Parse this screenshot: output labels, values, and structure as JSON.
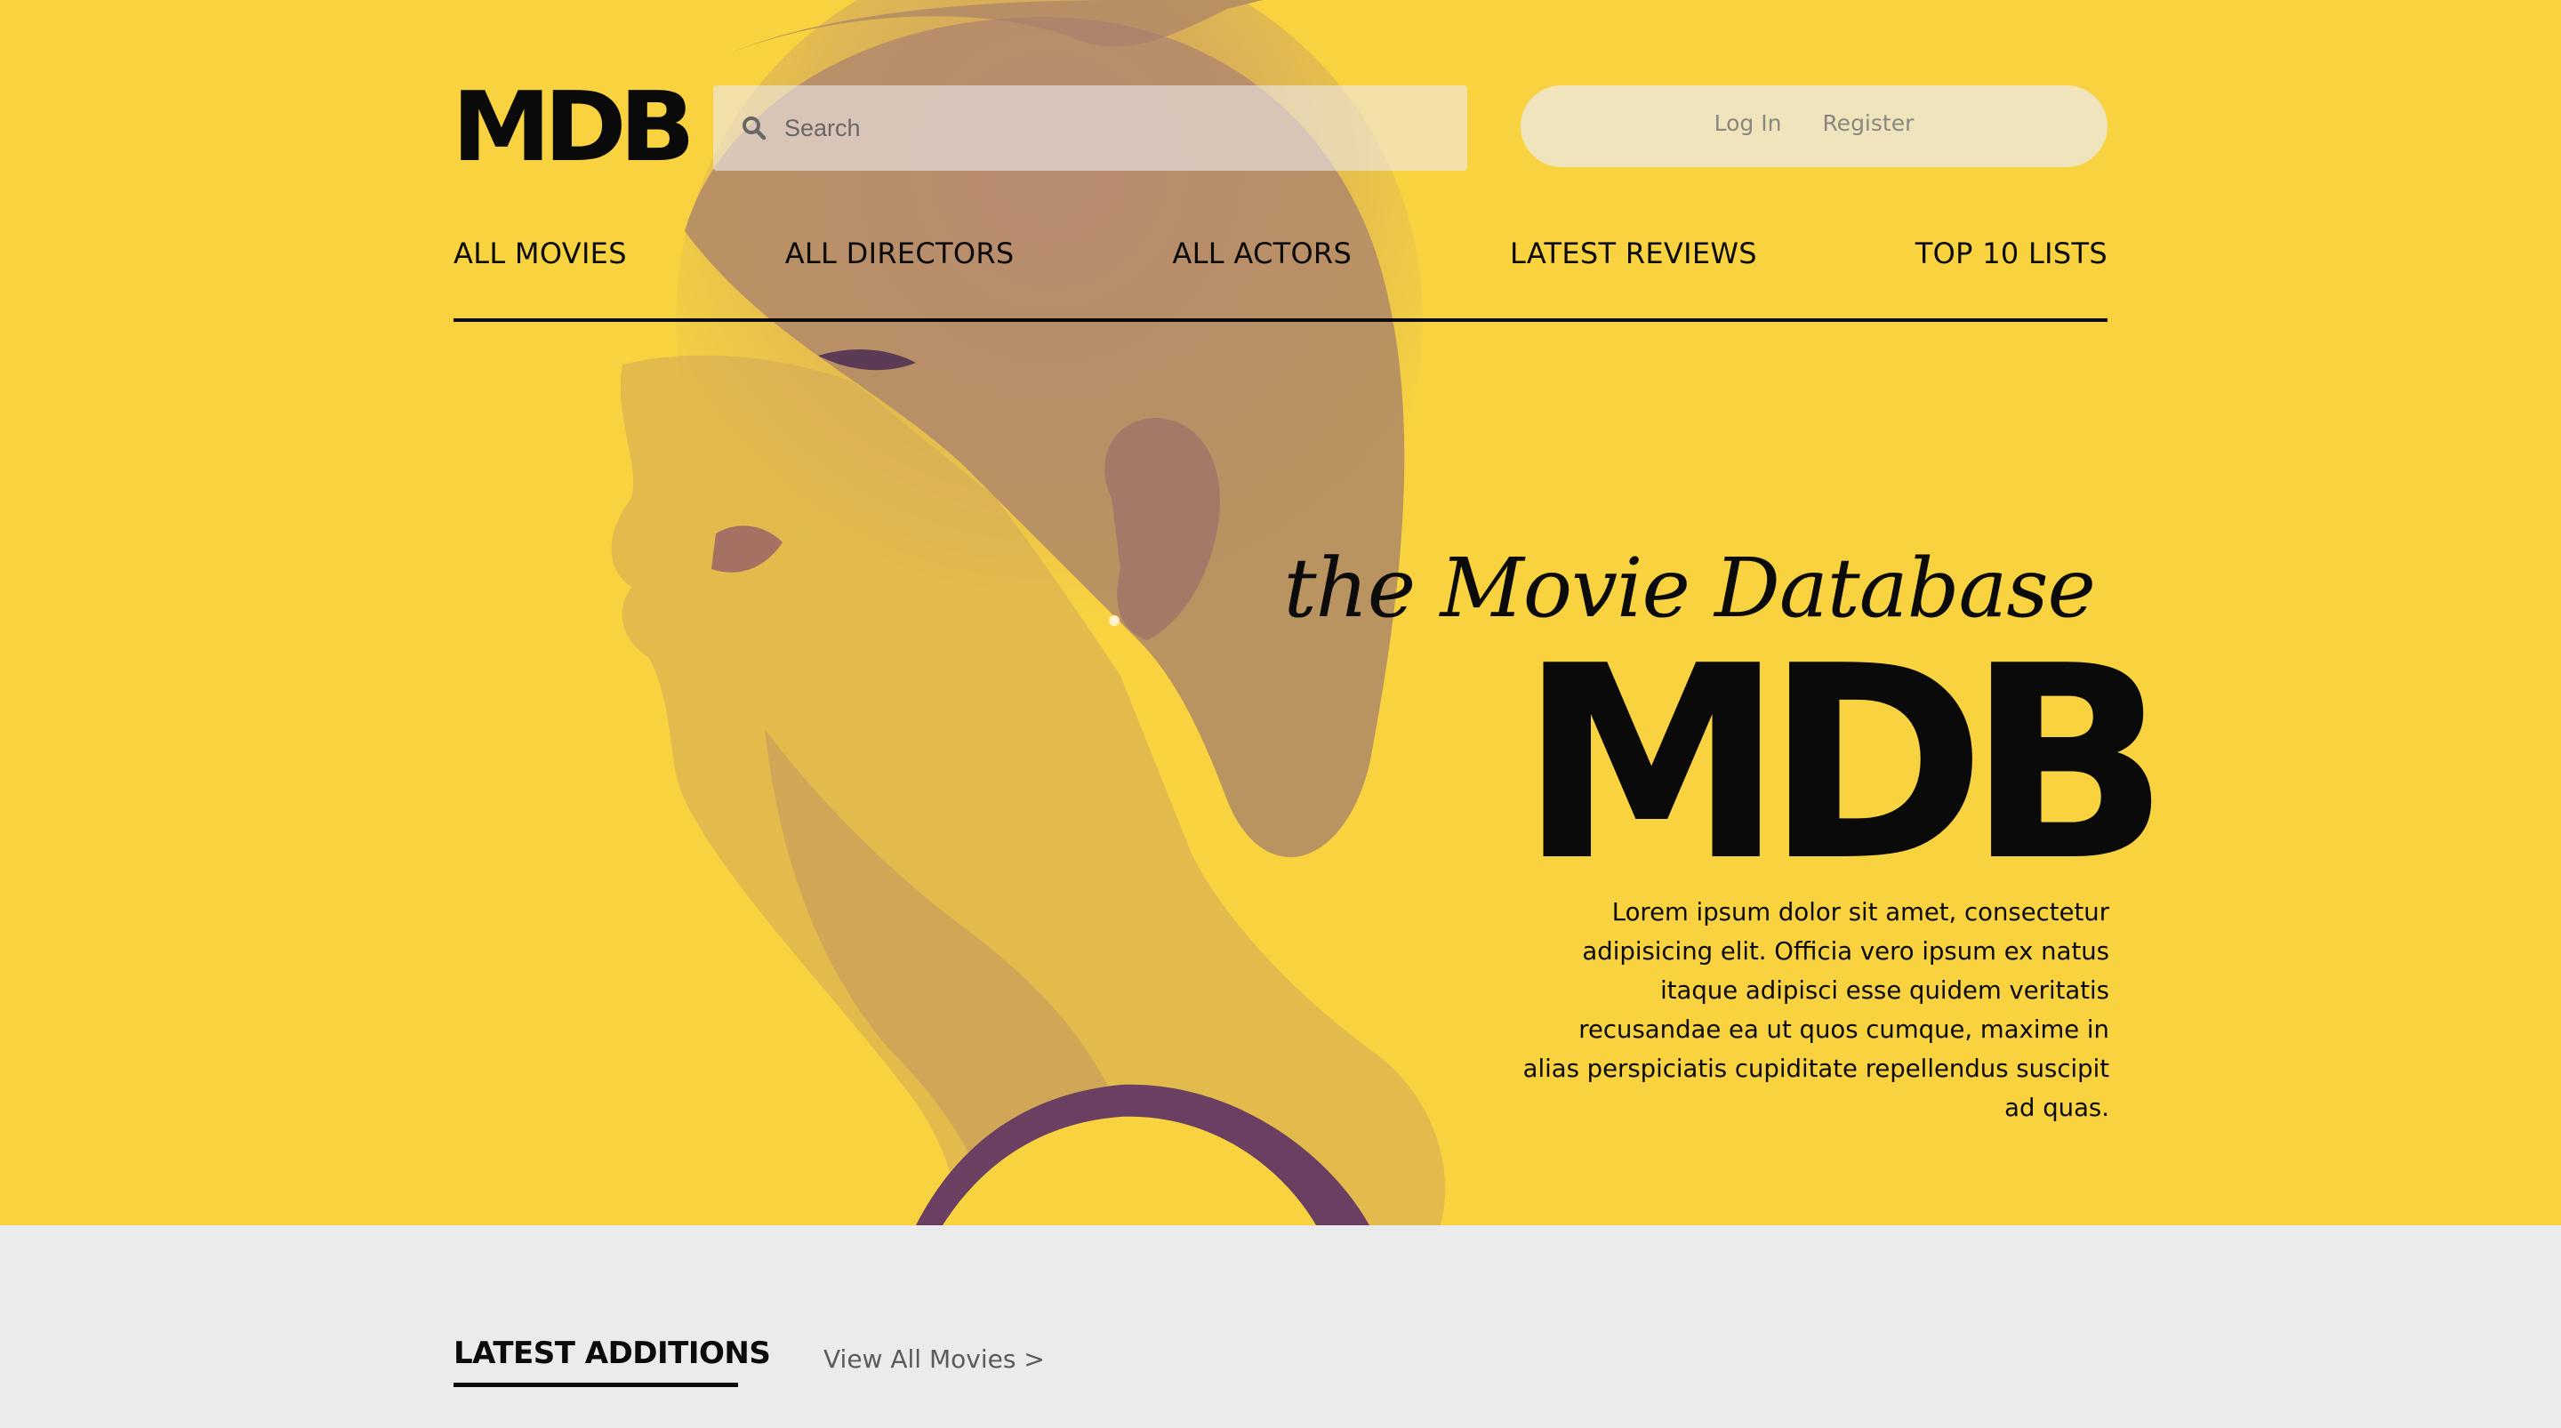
{
  "brand": {
    "logo_text": "MDB"
  },
  "search": {
    "placeholder": "Search",
    "value": ""
  },
  "auth": {
    "login_label": "Log In",
    "register_label": "Register"
  },
  "nav": {
    "items": [
      {
        "label": "ALL MOVIES"
      },
      {
        "label": "ALL DIRECTORS"
      },
      {
        "label": "ALL ACTORS"
      },
      {
        "label": "LATEST REVIEWS"
      },
      {
        "label": "TOP 10 LISTS"
      }
    ]
  },
  "hero": {
    "tagline": "the Movie Database",
    "big_logo": "MDB",
    "blurb": "Lorem ipsum dolor sit amet, consectetur adipisicing elit. Officia vero ipsum ex natus itaque adipisci esse quidem veritatis recusandae ea ut quos cumque, maxime in alias perspiciatis cupiditate repellendus suscipit ad quas."
  },
  "latest": {
    "title": "LATEST ADDITIONS",
    "view_all_label": "View All Movies >"
  },
  "colors": {
    "hero_bg": "#f8d33f",
    "page_bg": "#ecebeb",
    "text": "#0b0b0b",
    "duotone_shadow": "#7a4a6e"
  }
}
